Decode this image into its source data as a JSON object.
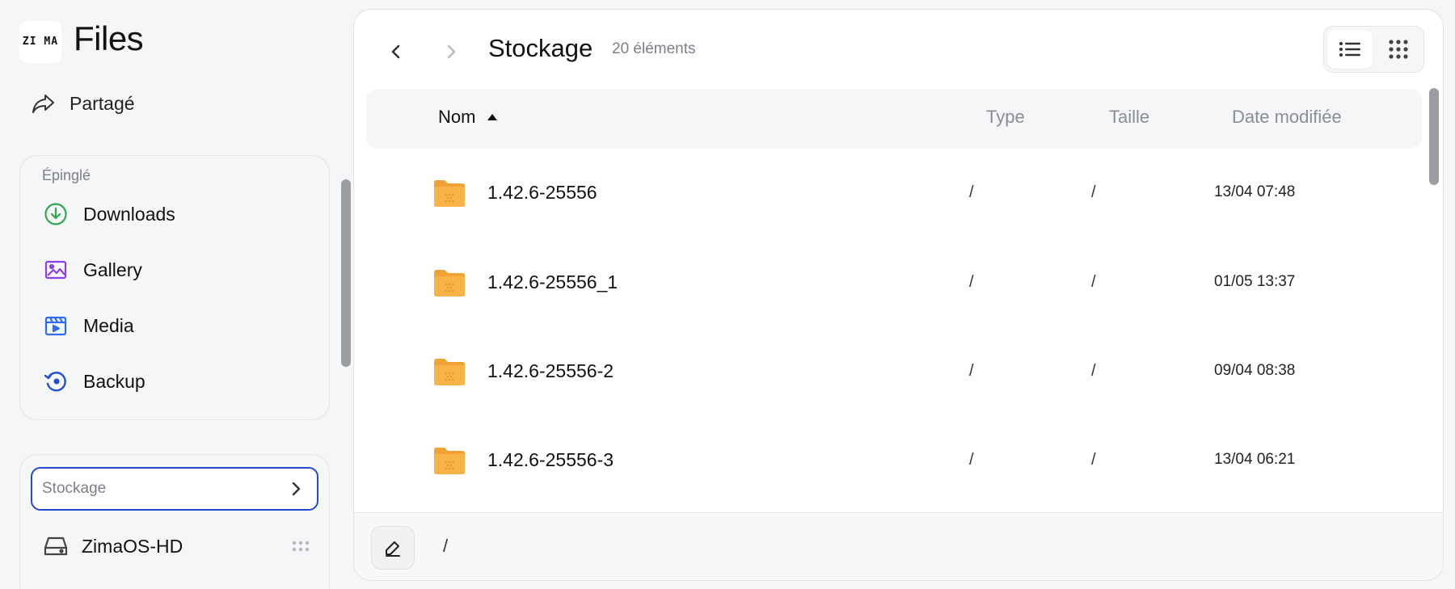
{
  "app": {
    "logo_text": "ZI MA",
    "title": "Files"
  },
  "sidebar": {
    "shared_label": "Partagé",
    "pinned": {
      "title": "Épinglé",
      "items": [
        {
          "label": "Downloads",
          "icon": "download-icon",
          "color": "#2fa84f"
        },
        {
          "label": "Gallery",
          "icon": "gallery-icon",
          "color": "#8a3ff0"
        },
        {
          "label": "Media",
          "icon": "media-icon",
          "color": "#2f6df0"
        },
        {
          "label": "Backup",
          "icon": "backup-icon",
          "color": "#1f4fd6"
        }
      ]
    },
    "storage": {
      "header_label": "Stockage",
      "disks": [
        {
          "label": "ZimaOS-HD",
          "icon": "hard-drive-icon"
        }
      ]
    }
  },
  "main": {
    "title": "Stockage",
    "item_count": "20 éléments",
    "view_mode": "list",
    "columns": {
      "name": "Nom",
      "type": "Type",
      "size": "Taille",
      "modified": "Date modifiée"
    },
    "sort": {
      "column": "name",
      "direction": "ascending"
    },
    "rows": [
      {
        "name": "1.42.6-25556",
        "type": "/",
        "size": "/",
        "modified": "13/04 07:48"
      },
      {
        "name": "1.42.6-25556_1",
        "type": "/",
        "size": "/",
        "modified": "01/05 13:37"
      },
      {
        "name": "1.42.6-25556-2",
        "type": "/",
        "size": "/",
        "modified": "09/04 08:38"
      },
      {
        "name": "1.42.6-25556-3",
        "type": "/",
        "size": "/",
        "modified": "13/04 06:21"
      }
    ],
    "footer_path": "/"
  },
  "colors": {
    "accent": "#2148d6",
    "folder": "#f5a93a"
  }
}
